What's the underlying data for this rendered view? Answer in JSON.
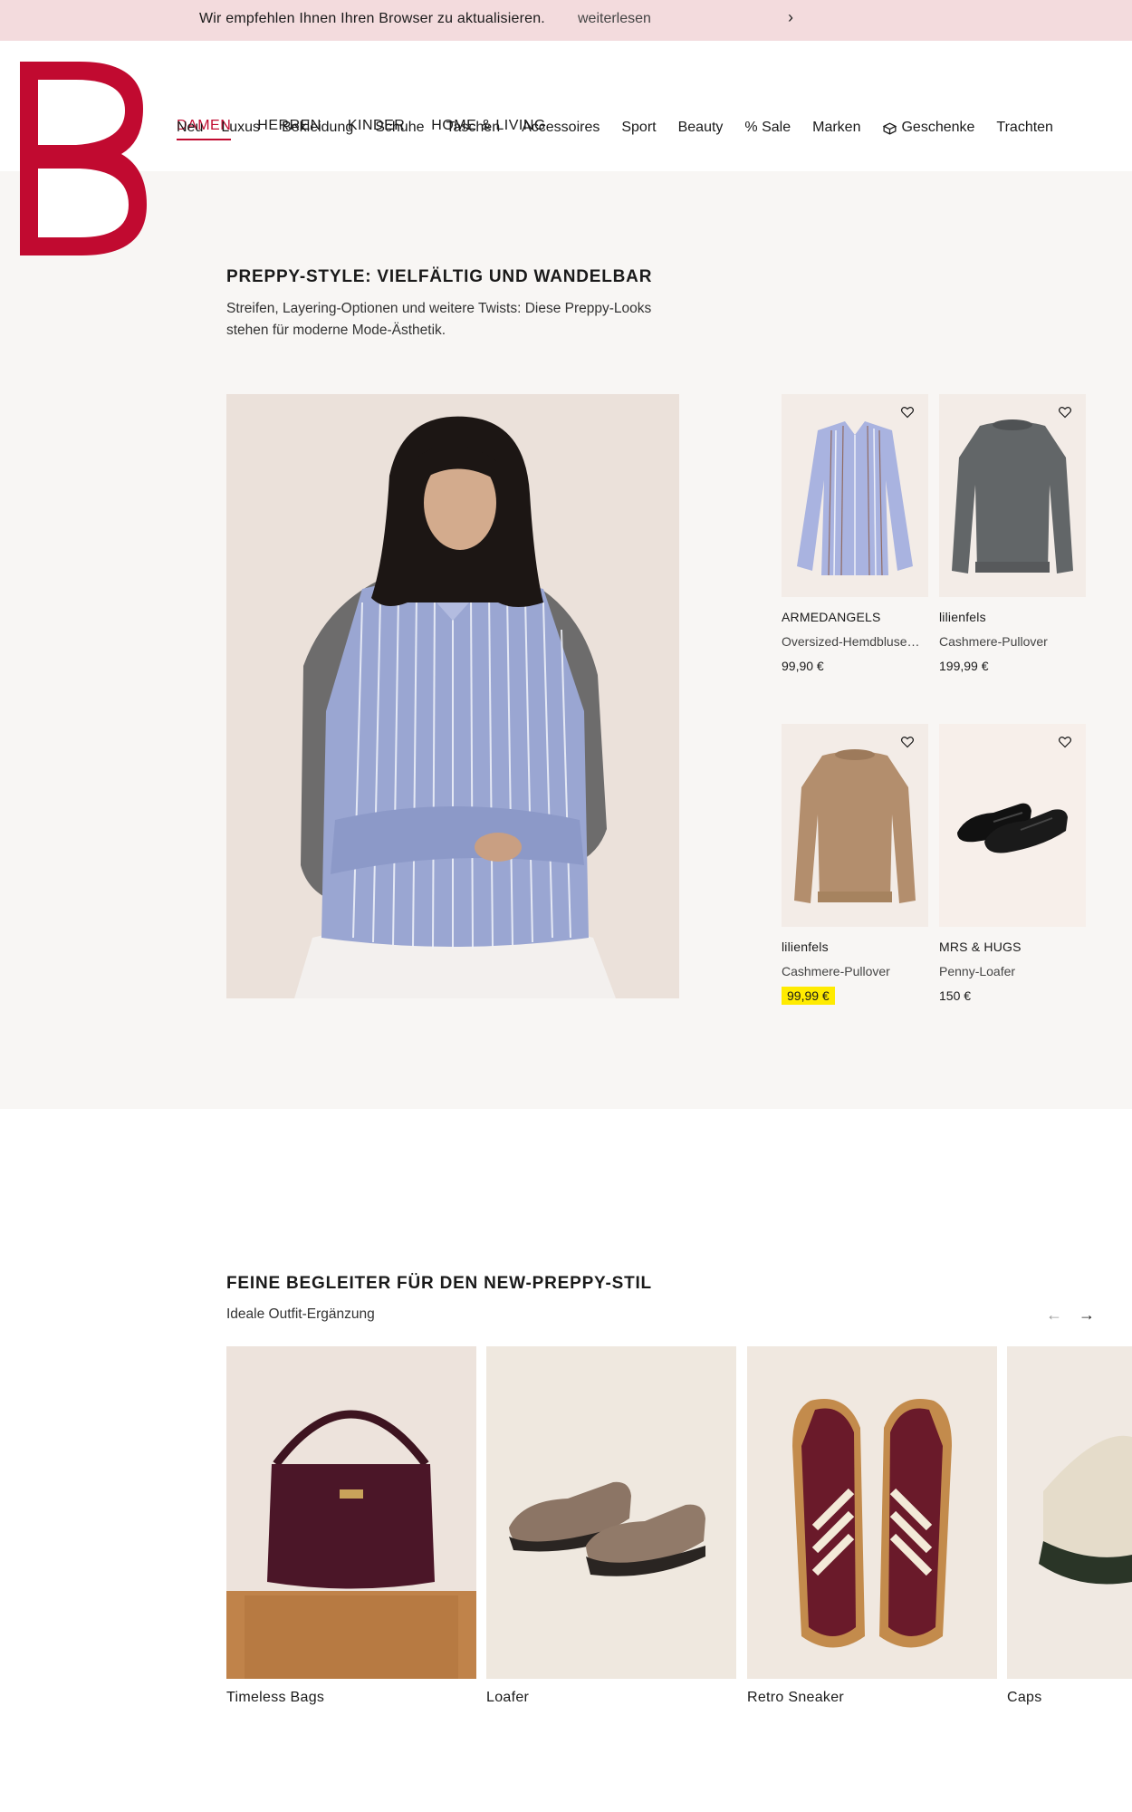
{
  "banner": {
    "text": "Wir empfehlen Ihnen Ihren Browser zu aktualisieren.",
    "link": "weiterlesen"
  },
  "nav": {
    "main": [
      "DAMEN",
      "HERREN",
      "KINDER",
      "HOME & LIVING"
    ],
    "sub": [
      "Neu",
      "Luxus",
      "Bekleidung",
      "Schuhe",
      "Taschen",
      "Accessoires",
      "Sport",
      "Beauty",
      "% Sale",
      "Marken",
      "Geschenke",
      "Trachten"
    ]
  },
  "section1": {
    "title": "PREPPY-STYLE: VIELFÄLTIG UND WANDELBAR",
    "description": "Streifen, Layering-Optionen und weitere Twists: Diese Preppy-Looks stehen für moderne Mode-Ästhetik.",
    "products": [
      {
        "brand": "ARMEDANGELS",
        "name": "Oversized-Hemdbluse…",
        "price": "99,90 €",
        "sale": false
      },
      {
        "brand": "lilienfels",
        "name": "Cashmere-Pullover",
        "price": "199,99 €",
        "sale": false
      },
      {
        "brand": "lilienfels",
        "name": "Cashmere-Pullover",
        "price": "99,99 €",
        "sale": true
      },
      {
        "brand": "MRS & HUGS",
        "name": "Penny-Loafer",
        "price": "150 €",
        "sale": false
      }
    ]
  },
  "section2": {
    "title": "FEINE BEGLEITER FÜR DEN NEW-PREPPY-STIL",
    "subtitle": "Ideale Outfit-Ergänzung",
    "tiles": [
      "Timeless Bags",
      "Loafer",
      "Retro Sneaker",
      "Caps"
    ]
  },
  "colors": {
    "brand": "#c10a30",
    "banner_bg": "#f3dbdd",
    "section_bg": "#f8f6f4",
    "sale_highlight": "#ffeb00"
  }
}
